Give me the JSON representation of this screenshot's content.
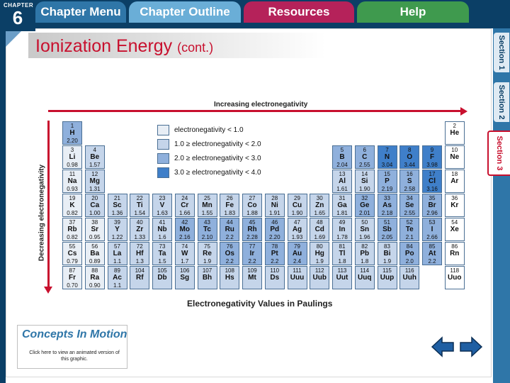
{
  "nav": {
    "chapter_label": "CHAPTER",
    "chapter_number": "6",
    "tabs": [
      "Chapter Menu",
      "Chapter Outline",
      "Resources",
      "Help"
    ]
  },
  "sections": [
    "Section 1",
    "Section 2",
    "Section 3"
  ],
  "slide": {
    "title": "Ionization Energy",
    "title_suffix": "(cont.)"
  },
  "figure": {
    "increasing_label": "Increasing electronegativity",
    "decreasing_label": "Decreasing electronegativity",
    "caption": "Electronegativity Values in Paulings",
    "legend": [
      {
        "text": "electronegativity < 1.0",
        "color": "#e8eef5"
      },
      {
        "text": "1.0 ≥ electronegativity < 2.0",
        "color": "#c5d5ea"
      },
      {
        "text": "2.0 ≥ electronegativity < 3.0",
        "color": "#8fb0dc"
      },
      {
        "text": "3.0 ≥ electronegativity < 4.0",
        "color": "#3f7fc9"
      }
    ],
    "elements": [
      {
        "n": "1",
        "s": "H",
        "v": "2.20",
        "r": 0,
        "c": 0,
        "t": 2
      },
      {
        "n": "2",
        "s": "He",
        "v": "",
        "r": 0,
        "c": 17,
        "t": -1
      },
      {
        "n": "3",
        "s": "Li",
        "v": "0.98",
        "r": 1,
        "c": 0,
        "t": 0
      },
      {
        "n": "4",
        "s": "Be",
        "v": "1.57",
        "r": 1,
        "c": 1,
        "t": 1
      },
      {
        "n": "5",
        "s": "B",
        "v": "2.04",
        "r": 1,
        "c": 12,
        "t": 2
      },
      {
        "n": "6",
        "s": "C",
        "v": "2.55",
        "r": 1,
        "c": 13,
        "t": 2
      },
      {
        "n": "7",
        "s": "N",
        "v": "3.04",
        "r": 1,
        "c": 14,
        "t": 3
      },
      {
        "n": "8",
        "s": "O",
        "v": "3.44",
        "r": 1,
        "c": 15,
        "t": 3
      },
      {
        "n": "9",
        "s": "F",
        "v": "3.98",
        "r": 1,
        "c": 16,
        "t": 3
      },
      {
        "n": "10",
        "s": "Ne",
        "v": "",
        "r": 1,
        "c": 17,
        "t": -1
      },
      {
        "n": "11",
        "s": "Na",
        "v": "0.93",
        "r": 2,
        "c": 0,
        "t": 0
      },
      {
        "n": "12",
        "s": "Mg",
        "v": "1.31",
        "r": 2,
        "c": 1,
        "t": 1
      },
      {
        "n": "13",
        "s": "Al",
        "v": "1.61",
        "r": 2,
        "c": 12,
        "t": 1
      },
      {
        "n": "14",
        "s": "Si",
        "v": "1.90",
        "r": 2,
        "c": 13,
        "t": 1
      },
      {
        "n": "15",
        "s": "P",
        "v": "2.19",
        "r": 2,
        "c": 14,
        "t": 2
      },
      {
        "n": "16",
        "s": "S",
        "v": "2.58",
        "r": 2,
        "c": 15,
        "t": 2
      },
      {
        "n": "17",
        "s": "Cl",
        "v": "3.16",
        "r": 2,
        "c": 16,
        "t": 3
      },
      {
        "n": "18",
        "s": "Ar",
        "v": "",
        "r": 2,
        "c": 17,
        "t": -1
      },
      {
        "n": "19",
        "s": "K",
        "v": "0.82",
        "r": 3,
        "c": 0,
        "t": 0
      },
      {
        "n": "20",
        "s": "Ca",
        "v": "1.00",
        "r": 3,
        "c": 1,
        "t": 1
      },
      {
        "n": "21",
        "s": "Sc",
        "v": "1.36",
        "r": 3,
        "c": 2,
        "t": 1
      },
      {
        "n": "22",
        "s": "Ti",
        "v": "1.54",
        "r": 3,
        "c": 3,
        "t": 1
      },
      {
        "n": "23",
        "s": "V",
        "v": "1.63",
        "r": 3,
        "c": 4,
        "t": 1
      },
      {
        "n": "24",
        "s": "Cr",
        "v": "1.66",
        "r": 3,
        "c": 5,
        "t": 1
      },
      {
        "n": "25",
        "s": "Mn",
        "v": "1.55",
        "r": 3,
        "c": 6,
        "t": 1
      },
      {
        "n": "26",
        "s": "Fe",
        "v": "1.83",
        "r": 3,
        "c": 7,
        "t": 1
      },
      {
        "n": "27",
        "s": "Co",
        "v": "1.88",
        "r": 3,
        "c": 8,
        "t": 1
      },
      {
        "n": "28",
        "s": "Ni",
        "v": "1.91",
        "r": 3,
        "c": 9,
        "t": 1
      },
      {
        "n": "29",
        "s": "Cu",
        "v": "1.90",
        "r": 3,
        "c": 10,
        "t": 1
      },
      {
        "n": "30",
        "s": "Zn",
        "v": "1.65",
        "r": 3,
        "c": 11,
        "t": 1
      },
      {
        "n": "31",
        "s": "Ga",
        "v": "1.81",
        "r": 3,
        "c": 12,
        "t": 1
      },
      {
        "n": "32",
        "s": "Ge",
        "v": "2.01",
        "r": 3,
        "c": 13,
        "t": 2
      },
      {
        "n": "33",
        "s": "As",
        "v": "2.18",
        "r": 3,
        "c": 14,
        "t": 2
      },
      {
        "n": "34",
        "s": "Se",
        "v": "2.55",
        "r": 3,
        "c": 15,
        "t": 2
      },
      {
        "n": "35",
        "s": "Br",
        "v": "2.96",
        "r": 3,
        "c": 16,
        "t": 2
      },
      {
        "n": "36",
        "s": "Kr",
        "v": "",
        "r": 3,
        "c": 17,
        "t": -1
      },
      {
        "n": "37",
        "s": "Rb",
        "v": "0.82",
        "r": 4,
        "c": 0,
        "t": 0
      },
      {
        "n": "38",
        "s": "Sr",
        "v": "0.95",
        "r": 4,
        "c": 1,
        "t": 0
      },
      {
        "n": "39",
        "s": "Y",
        "v": "1.22",
        "r": 4,
        "c": 2,
        "t": 1
      },
      {
        "n": "40",
        "s": "Zr",
        "v": "1.33",
        "r": 4,
        "c": 3,
        "t": 1
      },
      {
        "n": "41",
        "s": "Nb",
        "v": "1.6",
        "r": 4,
        "c": 4,
        "t": 1
      },
      {
        "n": "42",
        "s": "Mo",
        "v": "2.16",
        "r": 4,
        "c": 5,
        "t": 2
      },
      {
        "n": "43",
        "s": "Tc",
        "v": "2.10",
        "r": 4,
        "c": 6,
        "t": 2
      },
      {
        "n": "44",
        "s": "Ru",
        "v": "2.2",
        "r": 4,
        "c": 7,
        "t": 2
      },
      {
        "n": "45",
        "s": "Rh",
        "v": "2.28",
        "r": 4,
        "c": 8,
        "t": 2
      },
      {
        "n": "46",
        "s": "Pd",
        "v": "2.20",
        "r": 4,
        "c": 9,
        "t": 2
      },
      {
        "n": "47",
        "s": "Ag",
        "v": "1.93",
        "r": 4,
        "c": 10,
        "t": 1
      },
      {
        "n": "48",
        "s": "Cd",
        "v": "1.69",
        "r": 4,
        "c": 11,
        "t": 1
      },
      {
        "n": "49",
        "s": "In",
        "v": "1.78",
        "r": 4,
        "c": 12,
        "t": 1
      },
      {
        "n": "50",
        "s": "Sn",
        "v": "1.96",
        "r": 4,
        "c": 13,
        "t": 1
      },
      {
        "n": "51",
        "s": "Sb",
        "v": "2.05",
        "r": 4,
        "c": 14,
        "t": 2
      },
      {
        "n": "52",
        "s": "Te",
        "v": "2.1",
        "r": 4,
        "c": 15,
        "t": 2
      },
      {
        "n": "53",
        "s": "I",
        "v": "2.66",
        "r": 4,
        "c": 16,
        "t": 2
      },
      {
        "n": "54",
        "s": "Xe",
        "v": "",
        "r": 4,
        "c": 17,
        "t": -1
      },
      {
        "n": "55",
        "s": "Cs",
        "v": "0.79",
        "r": 5,
        "c": 0,
        "t": 0
      },
      {
        "n": "56",
        "s": "Ba",
        "v": "0.89",
        "r": 5,
        "c": 1,
        "t": 0
      },
      {
        "n": "57",
        "s": "La",
        "v": "1.1",
        "r": 5,
        "c": 2,
        "t": 1
      },
      {
        "n": "72",
        "s": "Hf",
        "v": "1.3",
        "r": 5,
        "c": 3,
        "t": 1
      },
      {
        "n": "73",
        "s": "Ta",
        "v": "1.5",
        "r": 5,
        "c": 4,
        "t": 1
      },
      {
        "n": "74",
        "s": "W",
        "v": "1.7",
        "r": 5,
        "c": 5,
        "t": 1
      },
      {
        "n": "75",
        "s": "Re",
        "v": "1.9",
        "r": 5,
        "c": 6,
        "t": 1
      },
      {
        "n": "76",
        "s": "Os",
        "v": "2.2",
        "r": 5,
        "c": 7,
        "t": 2
      },
      {
        "n": "77",
        "s": "Ir",
        "v": "2.2",
        "r": 5,
        "c": 8,
        "t": 2
      },
      {
        "n": "78",
        "s": "Pt",
        "v": "2.2",
        "r": 5,
        "c": 9,
        "t": 2
      },
      {
        "n": "79",
        "s": "Au",
        "v": "2.4",
        "r": 5,
        "c": 10,
        "t": 2
      },
      {
        "n": "80",
        "s": "Hg",
        "v": "1.9",
        "r": 5,
        "c": 11,
        "t": 1
      },
      {
        "n": "81",
        "s": "Tl",
        "v": "1.8",
        "r": 5,
        "c": 12,
        "t": 1
      },
      {
        "n": "82",
        "s": "Pb",
        "v": "1.8",
        "r": 5,
        "c": 13,
        "t": 1
      },
      {
        "n": "83",
        "s": "Bi",
        "v": "1.9",
        "r": 5,
        "c": 14,
        "t": 1
      },
      {
        "n": "84",
        "s": "Po",
        "v": "2.0",
        "r": 5,
        "c": 15,
        "t": 2
      },
      {
        "n": "85",
        "s": "At",
        "v": "2.2",
        "r": 5,
        "c": 16,
        "t": 2
      },
      {
        "n": "86",
        "s": "Rn",
        "v": "",
        "r": 5,
        "c": 17,
        "t": -1
      },
      {
        "n": "87",
        "s": "Fr",
        "v": "0.70",
        "r": 6,
        "c": 0,
        "t": 0
      },
      {
        "n": "88",
        "s": "Ra",
        "v": "0.90",
        "r": 6,
        "c": 1,
        "t": 0
      },
      {
        "n": "89",
        "s": "Ac",
        "v": "1.1",
        "r": 6,
        "c": 2,
        "t": 1
      },
      {
        "n": "104",
        "s": "Rf",
        "v": "",
        "r": 6,
        "c": 3,
        "t": 4
      },
      {
        "n": "105",
        "s": "Db",
        "v": "",
        "r": 6,
        "c": 4,
        "t": 4
      },
      {
        "n": "106",
        "s": "Sg",
        "v": "",
        "r": 6,
        "c": 5,
        "t": 4
      },
      {
        "n": "107",
        "s": "Bh",
        "v": "",
        "r": 6,
        "c": 6,
        "t": 4
      },
      {
        "n": "108",
        "s": "Hs",
        "v": "",
        "r": 6,
        "c": 7,
        "t": 4
      },
      {
        "n": "109",
        "s": "Mt",
        "v": "",
        "r": 6,
        "c": 8,
        "t": 4
      },
      {
        "n": "110",
        "s": "Ds",
        "v": "",
        "r": 6,
        "c": 9,
        "t": 4
      },
      {
        "n": "111",
        "s": "Uuu",
        "v": "",
        "r": 6,
        "c": 10,
        "t": 4
      },
      {
        "n": "112",
        "s": "Uub",
        "v": "",
        "r": 6,
        "c": 11,
        "t": 4
      },
      {
        "n": "113",
        "s": "Uut",
        "v": "",
        "r": 6,
        "c": 12,
        "t": 4
      },
      {
        "n": "114",
        "s": "Uuq",
        "v": "",
        "r": 6,
        "c": 13,
        "t": 4
      },
      {
        "n": "115",
        "s": "Uup",
        "v": "",
        "r": 6,
        "c": 14,
        "t": 4
      },
      {
        "n": "116",
        "s": "Uuh",
        "v": "",
        "r": 6,
        "c": 15,
        "t": 4
      },
      {
        "n": "118",
        "s": "Uuo",
        "v": "",
        "r": 6,
        "c": 17,
        "t": -1
      }
    ],
    "cell_colors": {
      "tier_0": "#e8eef5",
      "tier_1": "#c5d5ea",
      "tier_2": "#8fb0dc",
      "tier_3": "#3f7fc9",
      "tier_unknown": "#c5d5ea",
      "noble_gas": "#ffffff"
    }
  },
  "concepts": {
    "title": "Concepts In Motion",
    "subtitle": "Click here to view an animated version of this graphic."
  },
  "nav_arrows": {
    "prev_icon": "left-arrow-icon",
    "next_icon": "right-arrow-icon"
  },
  "colors": {
    "navy": "#0b3f66",
    "accent_red": "#c8102e"
  }
}
